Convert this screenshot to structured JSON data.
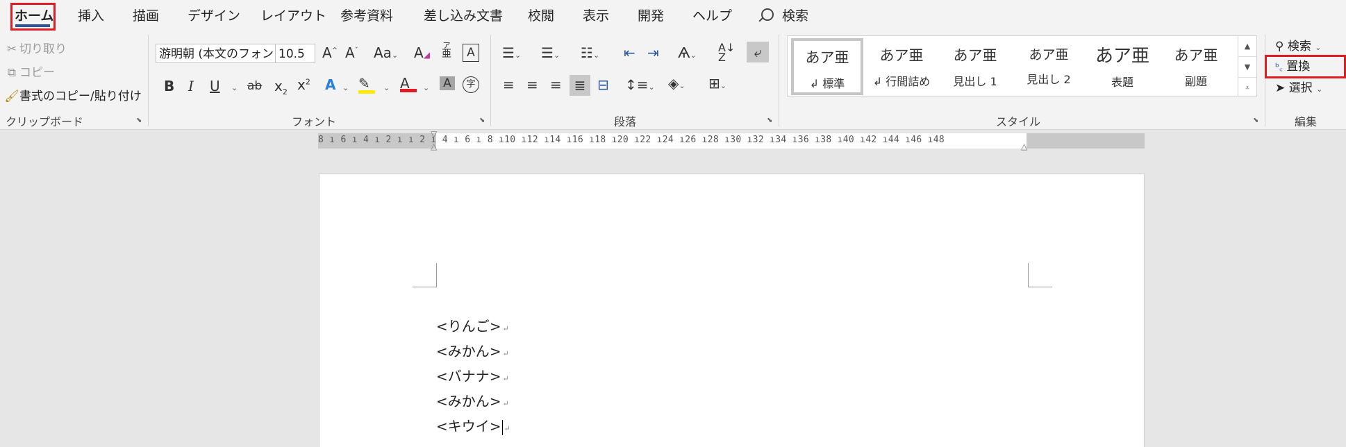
{
  "tabs": [
    "ホーム",
    "挿入",
    "描画",
    "デザイン",
    "レイアウト",
    "参考資料",
    "差し込み文書",
    "校閲",
    "表示",
    "開発",
    "ヘルプ"
  ],
  "tell_me": "検索",
  "clipboard": {
    "cut": "切り取り",
    "copy": "コピー",
    "format_painter": "書式のコピー/貼り付け",
    "label": "クリップボード"
  },
  "font": {
    "name": "游明朝 (本文のフォン",
    "size": "10.5",
    "label": "フォント",
    "ruby_top": "ア",
    "ruby_bottom": "亜",
    "enclose": "字",
    "case": "Aa"
  },
  "paragraph": {
    "label": "段落"
  },
  "styles": {
    "label": "スタイル",
    "items": [
      {
        "sample": "あア亜",
        "name": "↲ 標準"
      },
      {
        "sample": "あア亜",
        "name": "↲ 行間詰め"
      },
      {
        "sample": "あア亜",
        "name": "見出し 1"
      },
      {
        "sample": "あア亜",
        "name": "見出し 2"
      },
      {
        "sample": "あア亜",
        "name": "表題"
      },
      {
        "sample": "あア亜",
        "name": "副題"
      }
    ]
  },
  "editing": {
    "find": "検索",
    "replace": "置換",
    "select": "選択",
    "label": "編集"
  },
  "ruler": {
    "numbers": "8 ı 6 ı 4 ı 2 ı  ı 2 ı 4 ı 6 ı 8 ı10 ı12 ı14 ı16 ı18 ı20 ı22 ı24 ı26 ı28 ı30 ı32 ı34 ı36 ı38 ı40 ı42 ı44 ı46 ı48"
  },
  "document": {
    "lines": [
      "<りんご>",
      "<みかん>",
      "<バナナ>",
      "<みかん>",
      "<キウイ>"
    ]
  },
  "colors": {
    "accent": "#2b579a",
    "highlight": "#e01b24"
  }
}
